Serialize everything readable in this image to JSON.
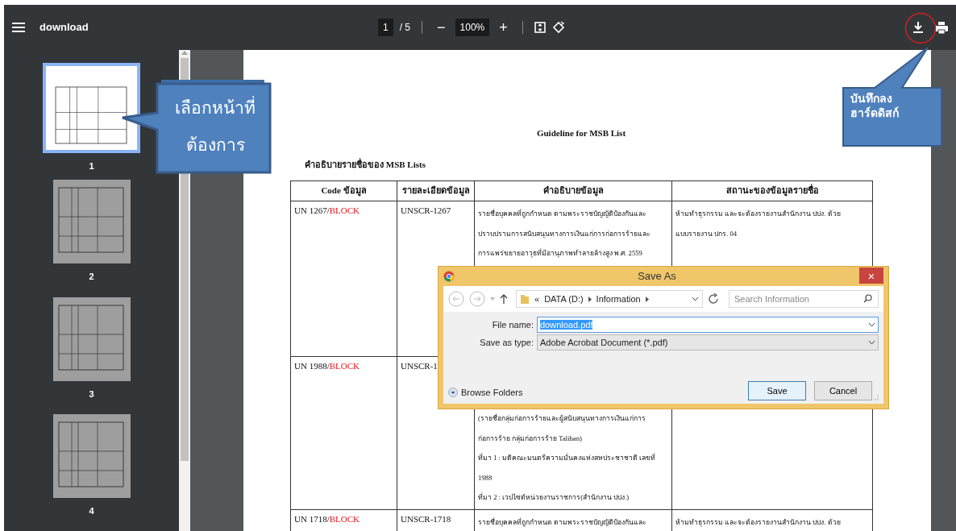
{
  "toolbar": {
    "title": "download",
    "page": "1",
    "page_count": "/ 5",
    "minus": "−",
    "zoom": "100%",
    "plus": "+"
  },
  "sidebar": {
    "thumbnails": [
      {
        "number": "1",
        "selected": true
      },
      {
        "number": "2",
        "selected": false
      },
      {
        "number": "3",
        "selected": false
      },
      {
        "number": "4",
        "selected": false
      }
    ]
  },
  "document": {
    "title": "Guideline for MSB List",
    "subtitle": "คำอธิบายรายชื่อของ MSB Lists",
    "table": {
      "columns": [
        "Code ข้อมูล",
        "รายละเอียดข้อมูล",
        "คำอธิบายข้อมูล",
        "สถานะของข้อมูลรายชื่อ"
      ],
      "rows": [
        {
          "code": "UN 1267/",
          "flag": "BLOCK",
          "detail": "UNSCR-1267",
          "description": "รายชื่อบุคคลที่ถูกกำหนด ตามพระราชบัญญัติป้องกันและ\nปราบปรามการสนับสนุนทางการเงินแก่การก่อการร้ายและ\nการแพร่ขยายอาวุธที่มีอานุภาพทำลายล้างสูง พ.ศ. 2559",
          "status": "ห้ามทำธุรกรรม และจะต้องรายงานสำนักงาน ปปง. ด้วย\nแบบรายงาน ปกร. 04"
        },
        {
          "code": "UN 1988/",
          "flag": "BLOCK",
          "detail": "UNSCR-1",
          "description": "(รายชื่อกลุ่มก่อการร้ายและผู้สนับสนุนทางการเงินแก่การ\nก่อการร้าย กลุ่มก่อการร้าย Taliban)\nที่มา 1 : มติคณะมนตรีความมั่นคงแห่งสหประชาชาติ เลขที่\n1988\nที่มา 2 : เวปไซต์หน่วยงานราชการ(สำนักงาน ปปง.)"
        },
        {
          "code": "UN 1718/",
          "flag": "BLOCK",
          "detail": "UNSCR-1718",
          "description": "รายชื่อบุคคลที่ถูกกำหนด ตามพระราชบัญญัติป้องกันและ",
          "status": "ห้ามทำธุรกรรม และจะต้องรายงานสำนักงาน ปปง. ด้วย"
        }
      ]
    }
  },
  "save_dialog": {
    "title": "Save As",
    "close": "×",
    "path_prefix": "«",
    "path": [
      "DATA (D:)",
      "Information"
    ],
    "search": {
      "placeholder": "Search Information"
    },
    "fields": [
      {
        "label": "File name:",
        "value": "download.pdf",
        "focused": true
      },
      {
        "label": "Save as type:",
        "value": "Adobe Acrobat Document (*.pdf)",
        "focused": false
      }
    ],
    "browse": "Browse Folders",
    "buttons": [
      {
        "label": "Save",
        "default": true
      },
      {
        "label": "Cancel",
        "default": false
      }
    ]
  },
  "callouts": [
    {
      "kind": "left",
      "text": "เลือกหน้าที่\nต้องการ"
    },
    {
      "kind": "up",
      "text": "บันทึกลง\nฮาร์ดดิสก์"
    }
  ]
}
